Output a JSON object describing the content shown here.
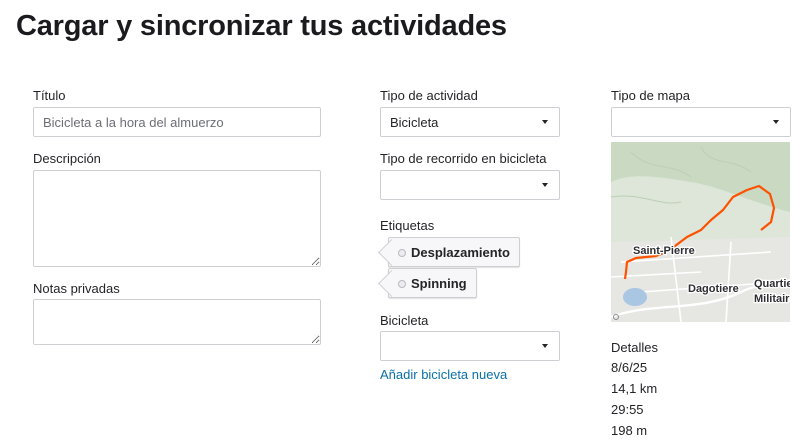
{
  "page": {
    "title": "Cargar y sincronizar tus actividades"
  },
  "form": {
    "titulo_label": "Título",
    "titulo_placeholder": "Bicicleta a la hora del almuerzo",
    "descripcion_label": "Descripción",
    "notas_label": "Notas privadas"
  },
  "activity": {
    "tipo_label": "Tipo de actividad",
    "tipo_value": "Bicicleta",
    "recorrido_label": "Tipo de recorrido en bicicleta",
    "recorrido_value": "",
    "etiquetas_label": "Etiquetas",
    "tags": [
      "Desplazamiento",
      "Spinning"
    ],
    "bicicleta_label": "Bicicleta",
    "bicicleta_value": "",
    "add_bike_link": "Añadir bicicleta nueva"
  },
  "map": {
    "tipo_label": "Tipo de mapa",
    "tipo_value": "",
    "places": [
      "Saint-Pierre",
      "Dagotiere",
      "Quartier",
      "Militaire"
    ],
    "route_color": "#fc5200"
  },
  "details": {
    "label": "Detalles",
    "date": "8/6/25",
    "distance": "14,1 km",
    "time": "29:55",
    "elevation": "198 m"
  }
}
